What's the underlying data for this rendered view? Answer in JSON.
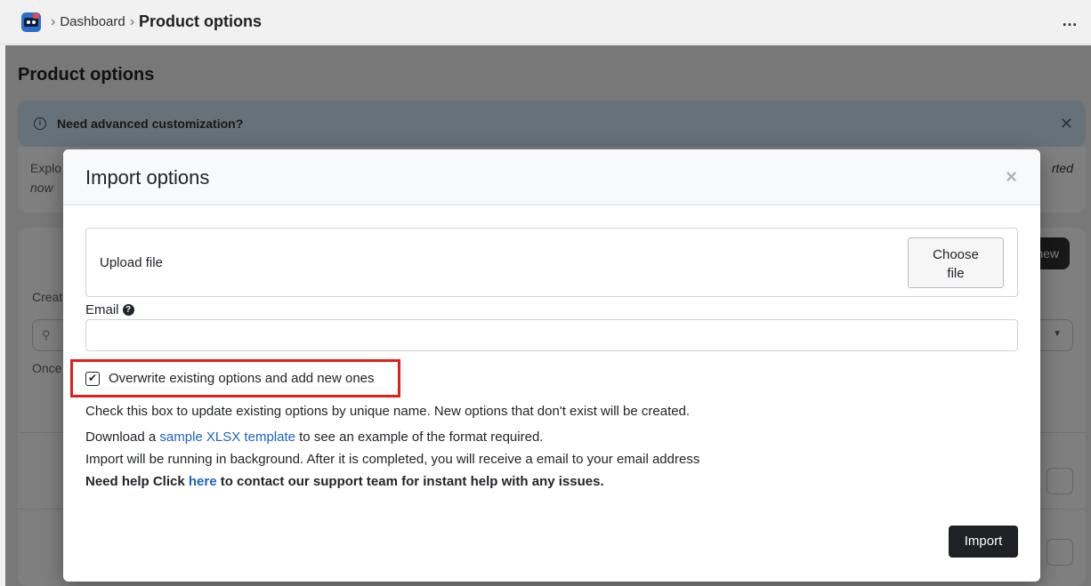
{
  "topbar": {
    "breadcrumb": [
      "Dashboard",
      "Product options"
    ],
    "separator": "›",
    "more_icon": "…"
  },
  "background": {
    "page_title": "Product options",
    "banner_title": "Need advanced customization?",
    "banner_close": "✕",
    "card_text_partial": "Explo",
    "card_text_partial2": "now",
    "card_text_right_partial": "rted",
    "new_button_partial": "new",
    "label_partial1": "Creat",
    "label_partial2": "Once"
  },
  "modal": {
    "title": "Import options",
    "close_symbol": "×",
    "upload_label": "Upload file",
    "choose_file_label_line1": "Choose",
    "choose_file_label_line2": "file",
    "email_label": "Email",
    "email_value": "",
    "overwrite_checked": true,
    "overwrite_label": "Overwrite existing options and add new ones",
    "overwrite_help": "Check this box to update existing options by unique name. New options that don't exist will be created.",
    "download_prefix": "Download a ",
    "download_link": "sample XLSX template",
    "download_suffix": " to see an example of the format required.",
    "background_note": "Import will be running in background. After it is completed, you will receive a email to your email address",
    "support_prefix": "Need help Click ",
    "support_link": "here",
    "support_suffix": " to contact our support team for instant help with any issues.",
    "import_button": "Import"
  },
  "colors": {
    "highlight": "#e0201b",
    "link": "#1a64c0",
    "primary_button": "#1f2124"
  },
  "icons": {
    "app": "app-logo-icon",
    "help": "question-circle-icon",
    "check": "checkmark-icon"
  }
}
